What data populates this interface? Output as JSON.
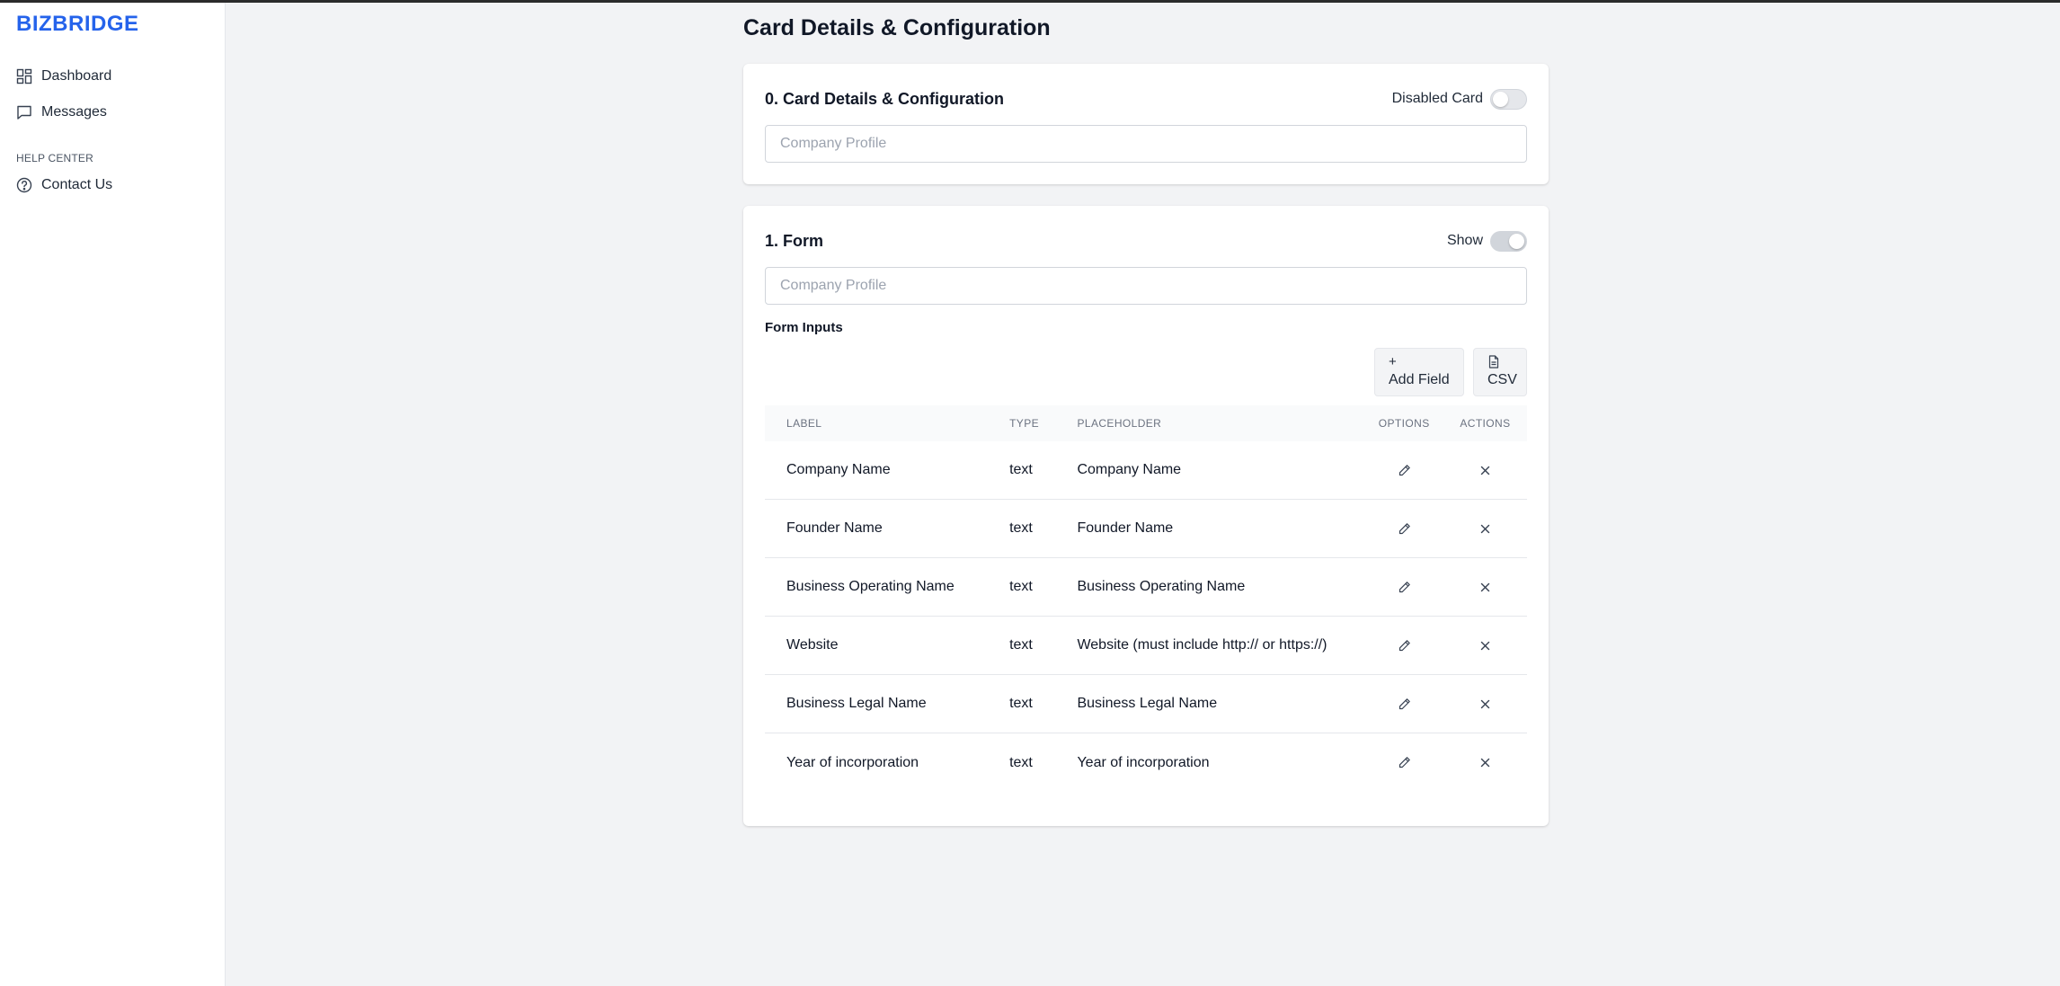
{
  "app": {
    "brand": "BIZBRIDGE"
  },
  "sidebar": {
    "items": [
      {
        "label": "Dashboard",
        "icon": "dashboard-icon"
      },
      {
        "label": "Messages",
        "icon": "message-icon"
      }
    ],
    "section_label": "HELP CENTER",
    "help_items": [
      {
        "label": "Contact Us",
        "icon": "help-circle-icon"
      }
    ]
  },
  "page": {
    "title": "Card Details & Configuration"
  },
  "card0": {
    "title": "0. Card Details & Configuration",
    "toggle_label": "Disabled Card",
    "toggle_on": false,
    "input_placeholder": "Company Profile",
    "input_value": ""
  },
  "card1": {
    "title": "1. Form",
    "toggle_label": "Show",
    "toggle_on": true,
    "input_placeholder": "Company Profile",
    "input_value": "",
    "subheading": "Form Inputs",
    "buttons": {
      "add_field": {
        "icon": "+",
        "label": "Add Field"
      },
      "csv": {
        "icon": "file-icon",
        "label": "CSV"
      }
    },
    "table": {
      "headers": [
        "LABEL",
        "TYPE",
        "PLACEHOLDER",
        "OPTIONS",
        "ACTIONS"
      ],
      "rows": [
        {
          "label": "Company Name",
          "type": "text",
          "placeholder": "Company Name"
        },
        {
          "label": "Founder Name",
          "type": "text",
          "placeholder": "Founder Name"
        },
        {
          "label": "Business Operating Name",
          "type": "text",
          "placeholder": "Business Operating Name"
        },
        {
          "label": "Website",
          "type": "text",
          "placeholder": "Website (must include http:// or https://)"
        },
        {
          "label": "Business Legal Name",
          "type": "text",
          "placeholder": "Business Legal Name"
        },
        {
          "label": "Year of incorporation",
          "type": "text",
          "placeholder": "Year of incorporation"
        }
      ]
    }
  },
  "colors": {
    "brand": "#2563eb",
    "background": "#f2f3f5",
    "card": "#ffffff"
  }
}
